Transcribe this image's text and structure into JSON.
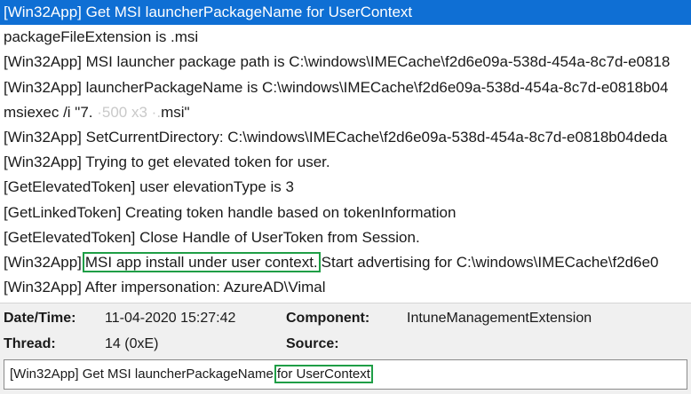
{
  "log": {
    "lines": [
      {
        "text": "[Win32App] Get MSI launcherPackageName for UserContext"
      },
      {
        "text": "packageFileExtension is .msi"
      },
      {
        "text": "[Win32App] MSI launcher package path is C:\\windows\\IMECache\\f2d6e09a-538d-454a-8c7d-e0818"
      },
      {
        "text": "[Win32App] launcherPackageName is C:\\windows\\IMECache\\f2d6e09a-538d-454a-8c7d-e0818b04"
      },
      {
        "text": "msiexec /i \"7.",
        "redacted": " ·500 x3 ·.",
        "suffix": "msi\""
      },
      {
        "text": "[Win32App] SetCurrentDirectory: C:\\windows\\IMECache\\f2d6e09a-538d-454a-8c7d-e0818b04deda"
      },
      {
        "text": "[Win32App] Trying to get elevated token for user."
      },
      {
        "text": "[GetElevatedToken] user elevationType is 3"
      },
      {
        "text": "[GetLinkedToken] Creating token handle based on tokenInformation"
      },
      {
        "text": "[GetElevatedToken] Close Handle of UserToken from Session."
      },
      {
        "prefix": "[Win32App]",
        "highlight": "MSI app install under user context.",
        "suffix": "Start advertising for C:\\windows\\IMECache\\f2d6e0"
      },
      {
        "text": "[Win32App] After impersonation: AzureAD\\Vimal"
      }
    ]
  },
  "details": {
    "datetime_label": "Date/Time:",
    "datetime_value": "11-04-2020 15:27:42",
    "component_label": "Component:",
    "component_value": "IntuneManagementExtension",
    "thread_label": "Thread:",
    "thread_value": "14 (0xE)",
    "source_label": "Source:",
    "source_value": ""
  },
  "message": {
    "prefix": "[Win32App] Get MSI launcherPackageName",
    "highlight": "for UserContext"
  },
  "colors": {
    "selection": "#0f6fd4",
    "highlight_border": "#1f9e46",
    "panel": "#f0f0f0"
  }
}
